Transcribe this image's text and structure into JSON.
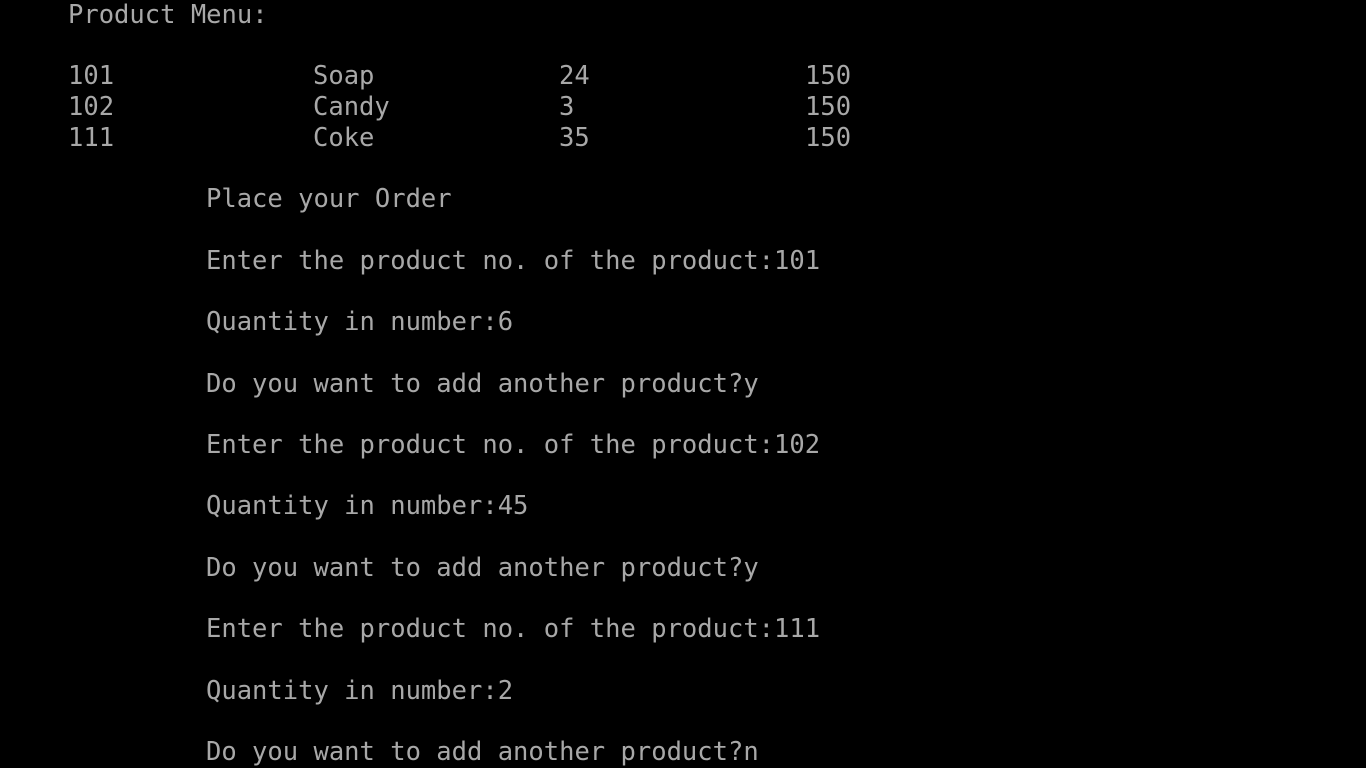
{
  "console": {
    "menu_title": "Product Menu:",
    "products": [
      {
        "no": "101",
        "name": "Soap",
        "price": "24",
        "stock": "150"
      },
      {
        "no": "102",
        "name": "Candy",
        "price": "3",
        "stock": "150"
      },
      {
        "no": "111",
        "name": "Coke",
        "price": "35",
        "stock": "150"
      }
    ],
    "order_heading": "Place your Order",
    "lines": [
      "Enter the product no. of the product:101",
      "Quantity in number:6",
      "Do you want to add another product?y",
      "Enter the product no. of the product:102",
      "Quantity in number:45",
      "Do you want to add another product?y",
      "Enter the product no. of the product:111",
      "Quantity in number:2",
      "Do you want to add another product?n"
    ]
  },
  "colors": {
    "background": "#000000",
    "text": "#a8a8a8"
  }
}
